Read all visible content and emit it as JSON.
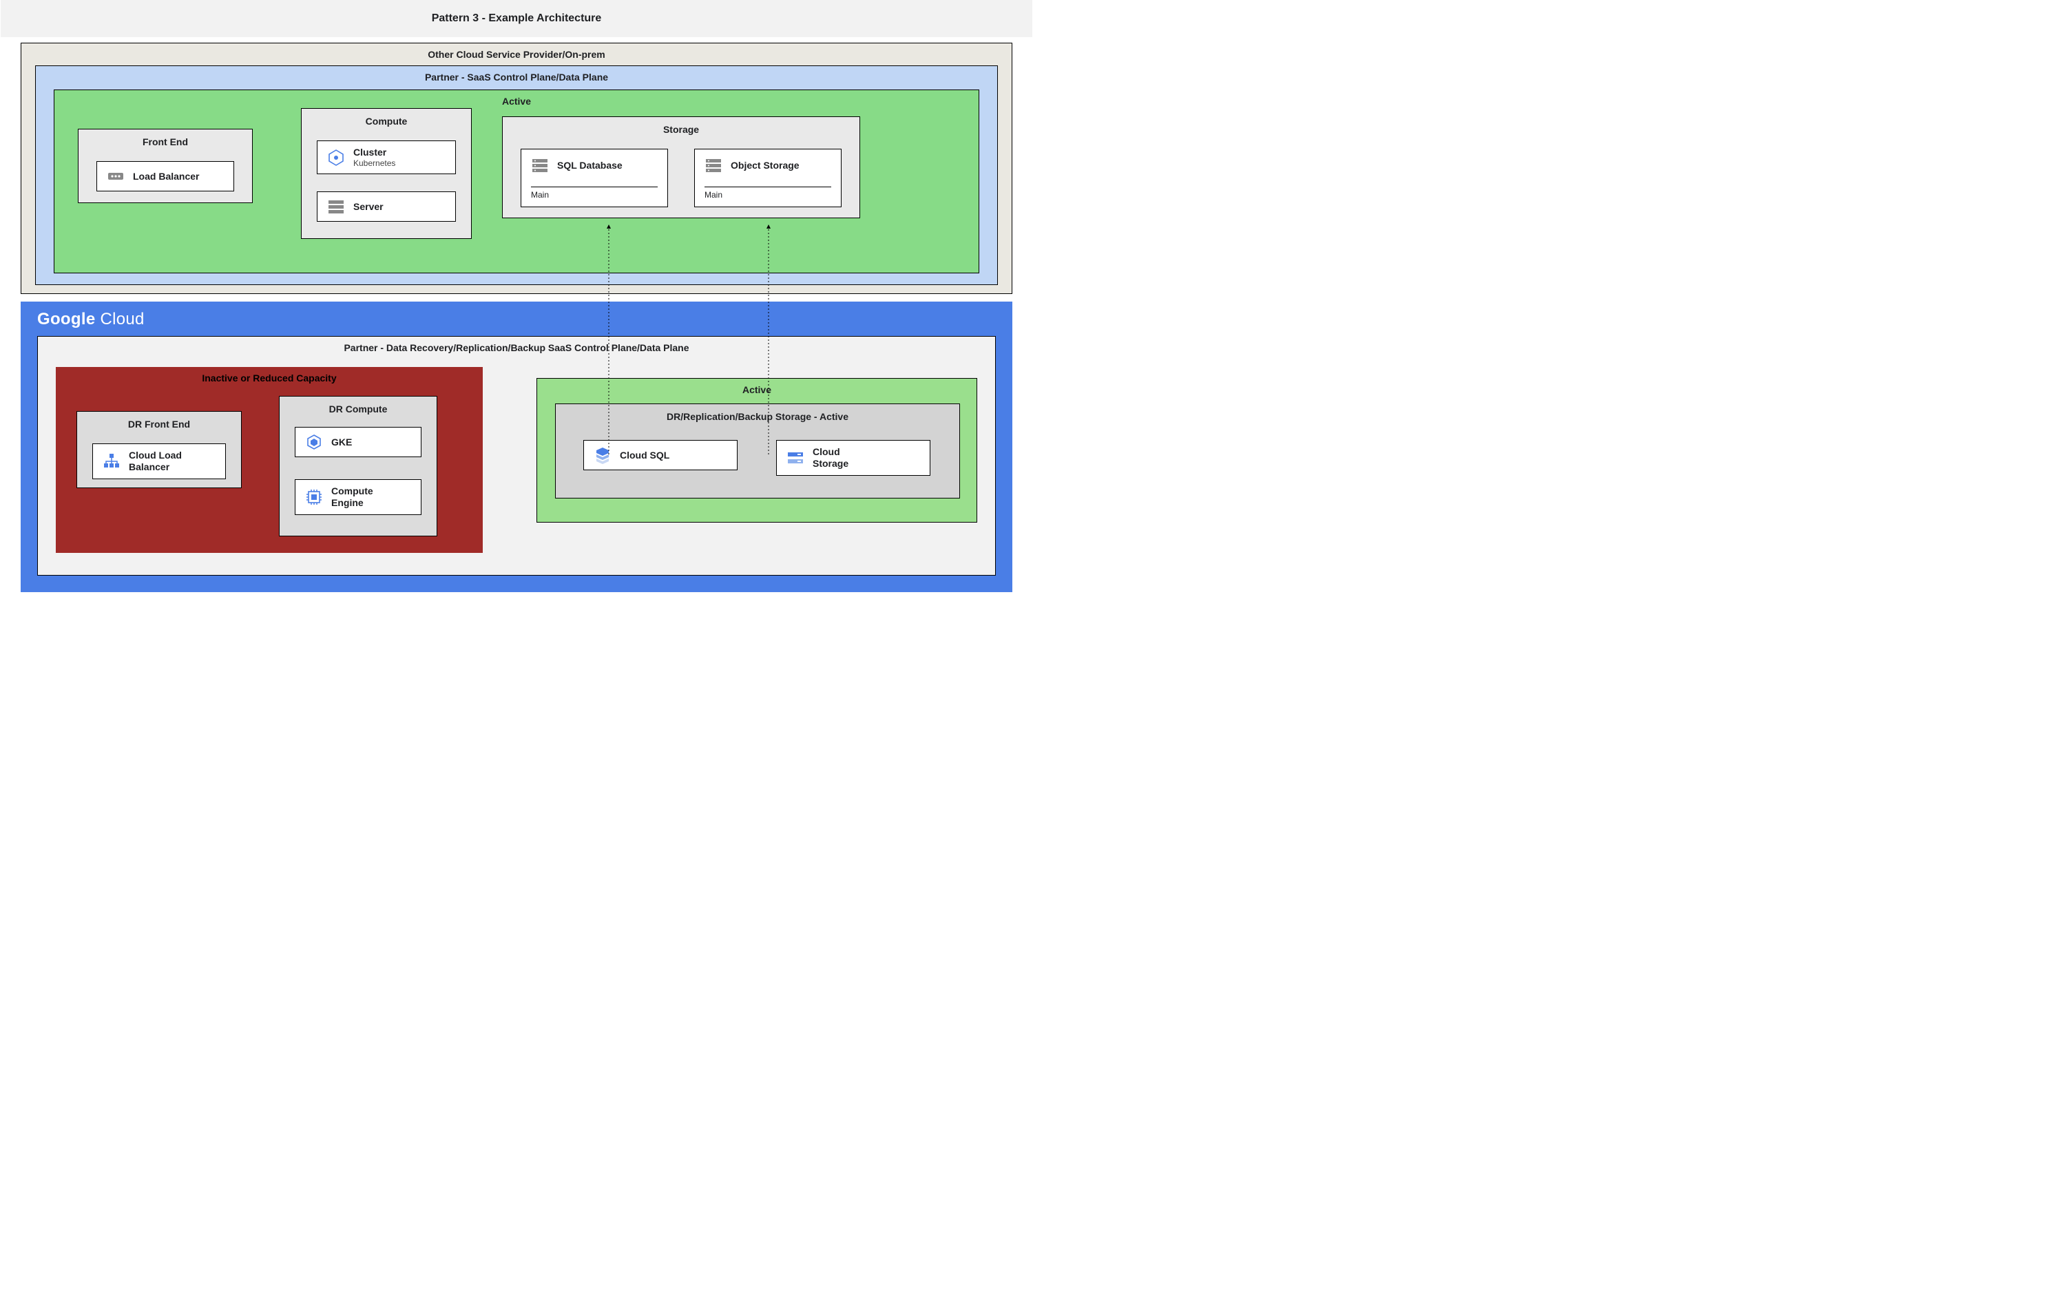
{
  "title": "Pattern 3 - Example Architecture",
  "onprem": {
    "title": "Other Cloud Service Provider/On-prem",
    "partner": {
      "title": "Partner - SaaS Control Plane/Data Plane"
    },
    "active": {
      "title": "Active"
    },
    "front_end": {
      "title": "Front End",
      "load_balancer": "Load Balancer"
    },
    "compute": {
      "title": "Compute",
      "cluster": {
        "label": "Cluster",
        "sub": "Kubernetes"
      },
      "server": "Server"
    },
    "storage": {
      "title": "Storage",
      "sql": {
        "label": "SQL Database",
        "footer": "Main"
      },
      "object": {
        "label": "Object Storage",
        "footer": "Main"
      }
    }
  },
  "google_cloud": {
    "brand_bold": "Google",
    "brand_light": "Cloud",
    "partner": {
      "title": "Partner - Data Recovery/Replication/Backup SaaS Control Plane/Data Plane"
    },
    "inactive": {
      "title": "Inactive or Reduced Capacity",
      "front_end": {
        "title": "DR Front End",
        "clb": {
          "label": "Cloud Load",
          "sub": "Balancer"
        }
      },
      "compute": {
        "title": "DR Compute",
        "gke": "GKE",
        "gce": {
          "label": "Compute",
          "sub": "Engine"
        }
      }
    },
    "active": {
      "title": "Active",
      "storage": {
        "title": "DR/Replication/Backup Storage - Active",
        "cloud_sql": "Cloud SQL",
        "cloud_storage": {
          "label": "Cloud",
          "sub": "Storage"
        }
      }
    }
  }
}
